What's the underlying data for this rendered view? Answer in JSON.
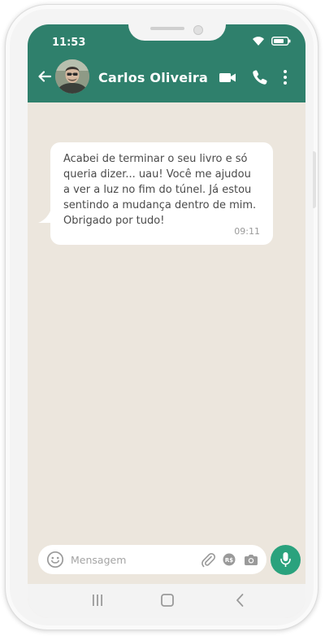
{
  "status_bar": {
    "time": "11:53"
  },
  "header": {
    "contact_name": "Carlos Oliveira",
    "back_icon": "arrow-left-icon",
    "video_icon": "video-camera-icon",
    "call_icon": "phone-icon",
    "menu_icon": "more-vertical-icon"
  },
  "messages": [
    {
      "text": "Acabei de terminar o seu livro e só queria dizer... uau! Você me ajudou a ver a luz no fim do túnel. Já estou sentindo a mudança dentro de mim. Obrigado por tudo!",
      "time": "09:11",
      "direction": "incoming"
    }
  ],
  "composer": {
    "placeholder": "Mensagem",
    "value": ""
  },
  "colors": {
    "header": "#2f806c",
    "chat_background": "#ece6dd",
    "bubble": "#ffffff",
    "mic_button": "#2aa27d"
  }
}
